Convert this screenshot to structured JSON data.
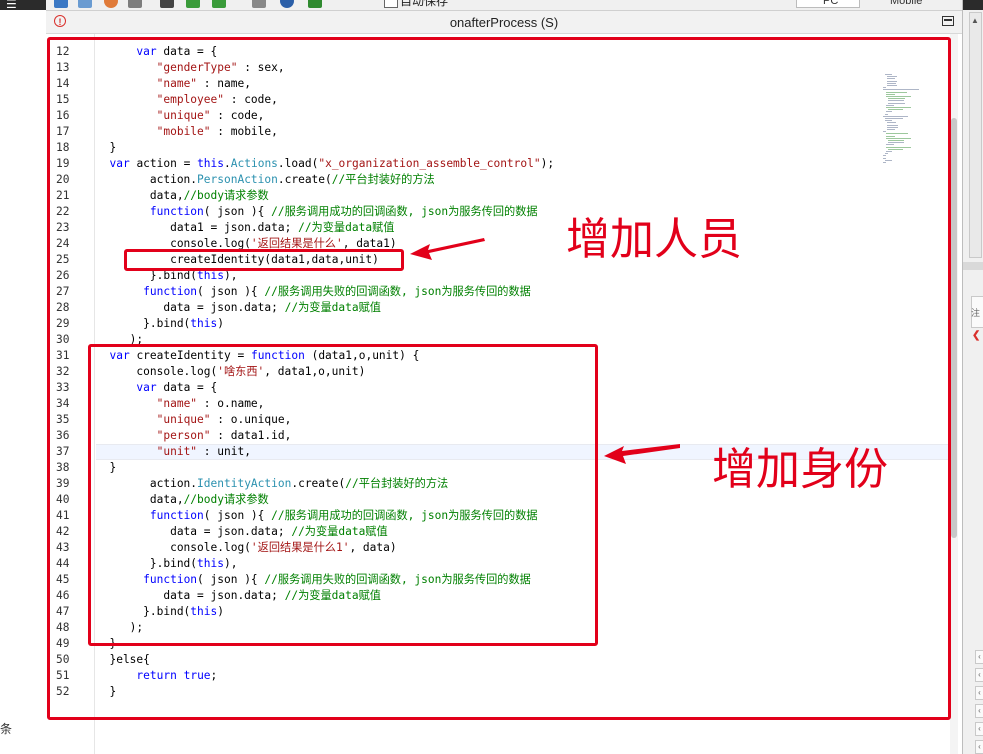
{
  "toolbar": {
    "autosave_label": "自动保存",
    "view_pc": "PC",
    "view_mobile": "Mobile"
  },
  "window": {
    "title": "onafterProcess (S)"
  },
  "left_panel": {
    "fragment_text": "条"
  },
  "right_panel": {
    "fragment_label": "注"
  },
  "annotations": {
    "add_person": "增加人员",
    "add_identity": "增加身份",
    "color": "#e2001a"
  },
  "code_lines": [
    {
      "n": "12",
      "cursor": false,
      "segs": [
        {
          "t": "      "
        },
        {
          "t": "var",
          "c": "k"
        },
        {
          "t": " data = {"
        }
      ]
    },
    {
      "n": "13",
      "cursor": false,
      "segs": [
        {
          "t": "         "
        },
        {
          "t": "\"genderType\"",
          "c": "s"
        },
        {
          "t": " : sex,"
        }
      ]
    },
    {
      "n": "14",
      "cursor": false,
      "segs": [
        {
          "t": "         "
        },
        {
          "t": "\"name\"",
          "c": "s"
        },
        {
          "t": " : name,"
        }
      ]
    },
    {
      "n": "15",
      "cursor": false,
      "segs": [
        {
          "t": "         "
        },
        {
          "t": "\"employee\"",
          "c": "s"
        },
        {
          "t": " : code,"
        }
      ]
    },
    {
      "n": "16",
      "cursor": false,
      "segs": [
        {
          "t": "         "
        },
        {
          "t": "\"unique\"",
          "c": "s"
        },
        {
          "t": " : code,"
        }
      ]
    },
    {
      "n": "17",
      "cursor": false,
      "segs": [
        {
          "t": "         "
        },
        {
          "t": "\"mobile\"",
          "c": "s"
        },
        {
          "t": " : mobile,"
        }
      ]
    },
    {
      "n": "18",
      "cursor": false,
      "segs": [
        {
          "t": "  }"
        }
      ]
    },
    {
      "n": "19",
      "cursor": false,
      "segs": [
        {
          "t": "  "
        },
        {
          "t": "var",
          "c": "k"
        },
        {
          "t": " action = "
        },
        {
          "t": "this",
          "c": "k"
        },
        {
          "t": "."
        },
        {
          "t": "Actions",
          "c": "p"
        },
        {
          "t": ".load("
        },
        {
          "t": "\"x_organization_assemble_control\"",
          "c": "s"
        },
        {
          "t": ");"
        }
      ]
    },
    {
      "n": "20",
      "cursor": false,
      "segs": [
        {
          "t": "        action."
        },
        {
          "t": "PersonAction",
          "c": "p"
        },
        {
          "t": ".create("
        },
        {
          "t": "//平台封装好的方法",
          "c": "c"
        }
      ]
    },
    {
      "n": "21",
      "cursor": false,
      "segs": [
        {
          "t": "        data,"
        },
        {
          "t": "//body请求参数",
          "c": "c"
        }
      ]
    },
    {
      "n": "22",
      "cursor": false,
      "segs": [
        {
          "t": "        "
        },
        {
          "t": "function",
          "c": "k"
        },
        {
          "t": "( json ){ "
        },
        {
          "t": "//服务调用成功的回调函数, json为服务传回的数据",
          "c": "c"
        }
      ]
    },
    {
      "n": "23",
      "cursor": false,
      "segs": [
        {
          "t": "           data1 = json.data; "
        },
        {
          "t": "//为变量data赋值",
          "c": "c"
        }
      ]
    },
    {
      "n": "24",
      "cursor": false,
      "segs": [
        {
          "t": "           console.log("
        },
        {
          "t": "'返回结果是什么'",
          "c": "s"
        },
        {
          "t": ", data1)"
        }
      ]
    },
    {
      "n": "25",
      "cursor": false,
      "segs": [
        {
          "t": "           createIdentity(data1,data,unit)"
        }
      ]
    },
    {
      "n": "26",
      "cursor": false,
      "segs": [
        {
          "t": "        }.bind("
        },
        {
          "t": "this",
          "c": "k"
        },
        {
          "t": "),"
        }
      ]
    },
    {
      "n": "27",
      "cursor": false,
      "segs": [
        {
          "t": "       "
        },
        {
          "t": "function",
          "c": "k"
        },
        {
          "t": "( json ){ "
        },
        {
          "t": "//服务调用失败的回调函数, json为服务传回的数据",
          "c": "c"
        }
      ]
    },
    {
      "n": "28",
      "cursor": false,
      "segs": [
        {
          "t": "          data = json.data; "
        },
        {
          "t": "//为变量data赋值",
          "c": "c"
        }
      ]
    },
    {
      "n": "29",
      "cursor": false,
      "segs": [
        {
          "t": "       }.bind("
        },
        {
          "t": "this",
          "c": "k"
        },
        {
          "t": ")"
        }
      ]
    },
    {
      "n": "30",
      "cursor": false,
      "segs": [
        {
          "t": "     );"
        }
      ]
    },
    {
      "n": "31",
      "cursor": false,
      "segs": [
        {
          "t": "  "
        },
        {
          "t": "var",
          "c": "k"
        },
        {
          "t": " createIdentity = "
        },
        {
          "t": "function",
          "c": "k"
        },
        {
          "t": " (data1,o,unit) {"
        }
      ]
    },
    {
      "n": "32",
      "cursor": false,
      "segs": [
        {
          "t": "      console.log("
        },
        {
          "t": "'啥东西'",
          "c": "s"
        },
        {
          "t": ", data1,o,unit)"
        }
      ]
    },
    {
      "n": "33",
      "cursor": false,
      "segs": [
        {
          "t": "      "
        },
        {
          "t": "var",
          "c": "k"
        },
        {
          "t": " data = {"
        }
      ]
    },
    {
      "n": "34",
      "cursor": false,
      "segs": [
        {
          "t": "         "
        },
        {
          "t": "\"name\"",
          "c": "s"
        },
        {
          "t": " : o.name,"
        }
      ]
    },
    {
      "n": "35",
      "cursor": false,
      "segs": [
        {
          "t": "         "
        },
        {
          "t": "\"unique\"",
          "c": "s"
        },
        {
          "t": " : o.unique,"
        }
      ]
    },
    {
      "n": "36",
      "cursor": false,
      "segs": [
        {
          "t": "         "
        },
        {
          "t": "\"person\"",
          "c": "s"
        },
        {
          "t": " : data1.id,"
        }
      ]
    },
    {
      "n": "37",
      "cursor": true,
      "segs": [
        {
          "t": "         "
        },
        {
          "t": "\"unit\"",
          "c": "s"
        },
        {
          "t": " : unit,"
        }
      ]
    },
    {
      "n": "38",
      "cursor": false,
      "segs": [
        {
          "t": "  }"
        }
      ]
    },
    {
      "n": "39",
      "cursor": false,
      "segs": [
        {
          "t": "        action."
        },
        {
          "t": "IdentityAction",
          "c": "p"
        },
        {
          "t": ".create("
        },
        {
          "t": "//平台封装好的方法",
          "c": "c"
        }
      ]
    },
    {
      "n": "40",
      "cursor": false,
      "segs": [
        {
          "t": "        data,"
        },
        {
          "t": "//body请求参数",
          "c": "c"
        }
      ]
    },
    {
      "n": "41",
      "cursor": false,
      "segs": [
        {
          "t": "        "
        },
        {
          "t": "function",
          "c": "k"
        },
        {
          "t": "( json ){ "
        },
        {
          "t": "//服务调用成功的回调函数, json为服务传回的数据",
          "c": "c"
        }
      ]
    },
    {
      "n": "42",
      "cursor": false,
      "segs": [
        {
          "t": "           data = json.data; "
        },
        {
          "t": "//为变量data赋值",
          "c": "c"
        }
      ]
    },
    {
      "n": "43",
      "cursor": false,
      "segs": [
        {
          "t": "           console.log("
        },
        {
          "t": "'返回结果是什么1'",
          "c": "s"
        },
        {
          "t": ", data)"
        }
      ]
    },
    {
      "n": "44",
      "cursor": false,
      "segs": [
        {
          "t": "        }.bind("
        },
        {
          "t": "this",
          "c": "k"
        },
        {
          "t": "),"
        }
      ]
    },
    {
      "n": "45",
      "cursor": false,
      "segs": [
        {
          "t": "       "
        },
        {
          "t": "function",
          "c": "k"
        },
        {
          "t": "( json ){ "
        },
        {
          "t": "//服务调用失败的回调函数, json为服务传回的数据",
          "c": "c"
        }
      ]
    },
    {
      "n": "46",
      "cursor": false,
      "segs": [
        {
          "t": "          data = json.data; "
        },
        {
          "t": "//为变量data赋值",
          "c": "c"
        }
      ]
    },
    {
      "n": "47",
      "cursor": false,
      "segs": [
        {
          "t": "       }.bind("
        },
        {
          "t": "this",
          "c": "k"
        },
        {
          "t": ")"
        }
      ]
    },
    {
      "n": "48",
      "cursor": false,
      "segs": [
        {
          "t": "     );"
        }
      ]
    },
    {
      "n": "49",
      "cursor": false,
      "segs": [
        {
          "t": "  }"
        }
      ]
    },
    {
      "n": "50",
      "cursor": false,
      "segs": [
        {
          "t": "  }else{"
        }
      ]
    },
    {
      "n": "51",
      "cursor": false,
      "segs": [
        {
          "t": "      "
        },
        {
          "t": "return",
          "c": "k"
        },
        {
          "t": " "
        },
        {
          "t": "true",
          "c": "k"
        },
        {
          "t": ";"
        }
      ]
    },
    {
      "n": "52",
      "cursor": false,
      "segs": [
        {
          "t": "  }"
        }
      ]
    }
  ]
}
